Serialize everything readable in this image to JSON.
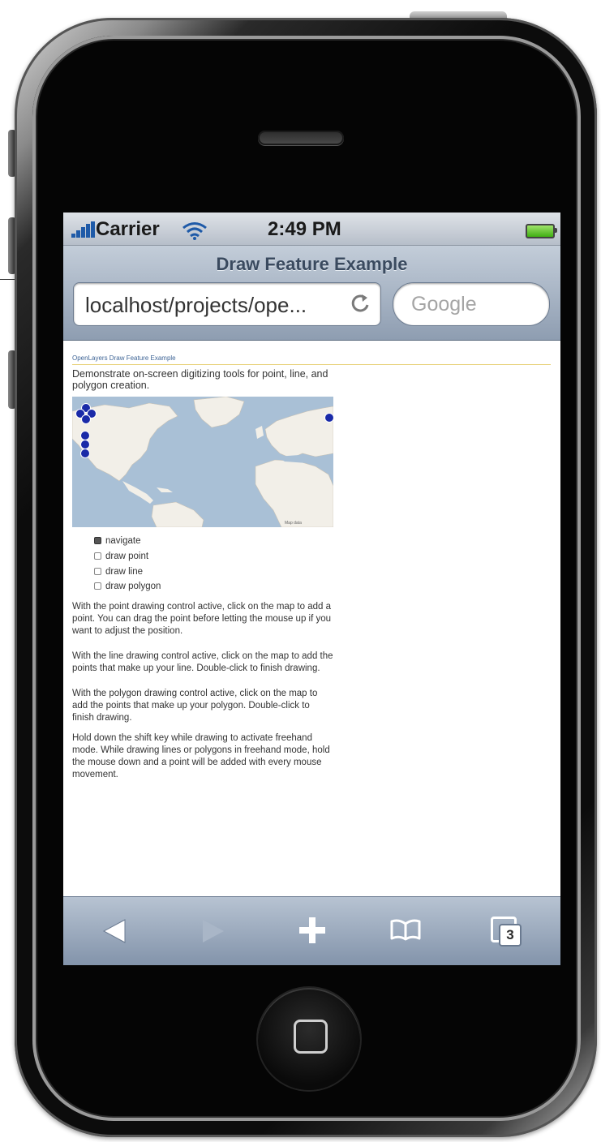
{
  "status_bar": {
    "carrier": "Carrier",
    "time": "2:49 PM",
    "signal_icon": "signal-bars-icon",
    "wifi_icon": "wifi-icon",
    "battery_icon": "battery-icon",
    "battery_level": 1.0,
    "battery_color": "#3fae12"
  },
  "browser": {
    "page_title": "Draw Feature Example",
    "url": "localhost/projects/ope...",
    "reload_icon": "reload-icon",
    "search_placeholder": "Google"
  },
  "page": {
    "header": "OpenLayers Draw Feature Example",
    "short_description": "Demonstrate on-screen digitizing tools for point, line, and polygon creation.",
    "map": {
      "pan_control": "pan-control-icon",
      "zoom_controls": "zoom-controls-icon",
      "layer_switcher": "layer-switcher-icon",
      "water_color": "#a9c0d6",
      "land_color": "#f2efe8"
    },
    "controls": [
      {
        "label": "navigate",
        "selected": true
      },
      {
        "label": "draw point",
        "selected": false
      },
      {
        "label": "draw line",
        "selected": false
      },
      {
        "label": "draw polygon",
        "selected": false
      }
    ],
    "paragraphs": [
      "With the point drawing control active, click on the map to add a point. You can drag the point before letting the mouse up if you want to adjust the position.",
      "With the line drawing control active, click on the map to add the points that make up your line. Double-click to finish drawing.",
      "With the polygon drawing control active, click on the map to add the points that make up your polygon. Double-click to finish drawing.",
      "Hold down the shift key while drawing to activate freehand mode. While drawing lines or polygons in freehand mode, hold the mouse down and a point will be added with every mouse movement."
    ]
  },
  "toolbar": {
    "back_icon": "back-arrow-icon",
    "forward_icon": "forward-arrow-icon",
    "add_icon": "plus-icon",
    "bookmarks_icon": "bookmarks-icon",
    "pages_icon": "pages-icon",
    "pages_count": "3"
  },
  "device": {
    "home_button_icon": "home-button-icon",
    "speaker": "speaker-grille"
  }
}
